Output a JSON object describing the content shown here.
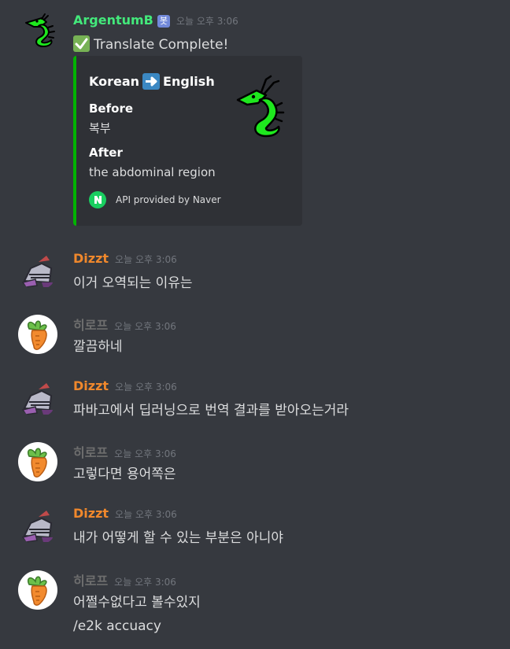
{
  "colors": {
    "background": "#36393f",
    "embed_background": "#2f3136",
    "embed_accent": "#00b300",
    "bot_name": "#43e97b",
    "dizzt_name": "#f0882c",
    "hirope_name": "#6e6e6e",
    "bot_tag": "#7289da",
    "text": "#dcddde",
    "timestamp": "#72767d"
  },
  "messages": [
    {
      "author": "ArgentumB",
      "bot_tag": "봇",
      "timestamp": "오늘 오후 3:06",
      "avatar_icon": "green-dragon-icon",
      "check_icon": "check-mark-icon",
      "text": "Translate Complete!",
      "embed": {
        "title_from": "Korean",
        "title_to": "English",
        "arrow_icon": "right-arrow-icon",
        "thumbnail_icon": "green-dragon-icon",
        "fields": [
          {
            "name": "Before",
            "value": "복부"
          },
          {
            "name": "After",
            "value": "the abdominal region"
          }
        ],
        "footer_icon": "naver-icon",
        "footer_text": "API provided by Naver"
      }
    },
    {
      "author": "Dizzt",
      "timestamp": "오늘 오후 3:06",
      "avatar_icon": "knight-icon",
      "text": "이거 오역되는 이유는"
    },
    {
      "author": "히로프",
      "timestamp": "오늘 오후 3:06",
      "avatar_icon": "carrot-icon",
      "text": "깔끔하네"
    },
    {
      "author": "Dizzt",
      "timestamp": "오늘 오후 3:06",
      "avatar_icon": "knight-icon",
      "text": "파바고에서 딥러닝으로 번역 결과를 받아오는거라"
    },
    {
      "author": "히로프",
      "timestamp": "오늘 오후 3:06",
      "avatar_icon": "carrot-icon",
      "text": "고렇다면 용어쪽은"
    },
    {
      "author": "Dizzt",
      "timestamp": "오늘 오후 3:06",
      "avatar_icon": "knight-icon",
      "text": "내가 어떻게 할 수 있는 부분은 아니야"
    },
    {
      "author": "히로프",
      "timestamp": "오늘 오후 3:06",
      "avatar_icon": "carrot-icon",
      "text": "어쩔수없다고 볼수있지",
      "text2": "/e2k accuacy"
    }
  ]
}
